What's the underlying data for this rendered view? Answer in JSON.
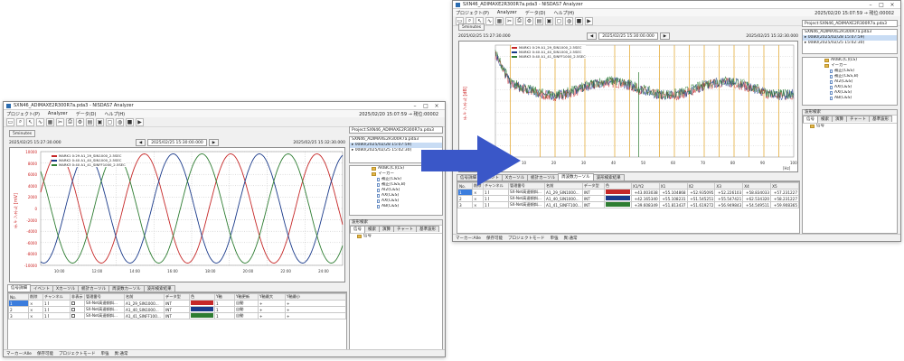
{
  "app": {
    "title": "SXN46_ADIMAXE2R300R7a.pda3 - NISDAS7 Analyzer",
    "menu": [
      "プロジェクト(P)",
      "Analyzer",
      "データ(D)",
      "ヘルプ(H)"
    ],
    "datetime": "2025/02/20 15:07:59 → 残位:00002"
  },
  "left": {
    "project": "Project:SXN46_ADIMAXE2R300R7a.pda3",
    "interval": "5minutes",
    "time_start": "2025/02/25 15:27:30.000",
    "time_center": "2025/02/25 15:30:00.000",
    "time_end": "2025/02/25 15:32:30.000",
    "y_axis_label": "チャンネル [mV]",
    "y_ticks": [
      "10000",
      "8000",
      "6000",
      "4000",
      "2000",
      "0",
      "-2000",
      "-4000",
      "-6000",
      "-8000",
      "-10000"
    ],
    "x_ticks": [
      "10:00",
      "12:00",
      "14:00",
      "16:00",
      "18:00",
      "20:00",
      "22:00",
      "24:00"
    ],
    "legend": [
      "MARK1 0:29 A1_29_SIN1000_2.5SEC",
      "MARK2 0:40 A1_40_SIN1000_2.5SEC",
      "MARK3 0:40 A1_41_SINFF1000_2.5SEC"
    ],
    "file_items": [
      "SXN46_ADIMAXE2R300R7a.pda3",
      "▸ 0080(2025/02/28 15:07:59)",
      "▸ 0080(2025/02/25 15:02:30)"
    ],
    "tree_items": [
      "AI0BC(C)(LS)",
      "マーカー",
      "補正(C&S)",
      "補正(C&S,B)",
      "AI2(C&S)",
      "AX(C&S)",
      "AX(C&S)",
      "AB(C&S)"
    ],
    "tabs": [
      "信号詳細",
      "イベント",
      "Xカーソル",
      "統計カーソル",
      "周波数カーソル",
      "波形検索結果"
    ],
    "columns": [
      "No.",
      "削除",
      "チャンネル",
      "非表示",
      "管理番号",
      "名前",
      "データ型",
      "色",
      "Y軸",
      "Y軸更新",
      "Y軸最大",
      "Y軸最小"
    ],
    "rows": [
      {
        "no": "1",
        "del": "×",
        "ch": "1",
        "mgmt": "SX-Net高速傾斜...",
        "name": "A1_29_SIN1000...",
        "type": "INT",
        "color": "#c62828",
        "y": "1",
        "yupd": "自動",
        "ymax": "+",
        "ymin": "+"
      },
      {
        "no": "2",
        "del": "×",
        "ch": "1",
        "mgmt": "SX-Net高速傾斜...",
        "name": "A1_40_SIN1000...",
        "type": "INT",
        "color": "#1a3a8a",
        "y": "1",
        "yupd": "自動",
        "ymax": "+",
        "ymin": "+"
      },
      {
        "no": "3",
        "del": "×",
        "ch": "1",
        "mgmt": "SX-Net高速傾斜...",
        "name": "A1_41_SINFF100...",
        "type": "INT",
        "color": "#2e7d32",
        "y": "1",
        "yupd": "自動",
        "ymax": "+",
        "ymin": "+"
      }
    ],
    "search_header": "波形検索",
    "search_tabs": [
      "信号",
      "検索",
      "演算",
      "チャート",
      "基準波形"
    ],
    "search_item": "信号",
    "status": [
      "マーカー:AIle",
      "保存可能",
      "プロジェクトモード",
      "単強",
      "異:通常"
    ]
  },
  "right": {
    "project": "Project:SXN46_ADIMAXE2R300R7a.pda3",
    "interval": "5minutes",
    "time_start": "2025/02/25 15:27:30.000",
    "time_center": "2025/02/25 15:30:00.000",
    "time_end": "2025/02/25 15:32:30.000",
    "y_axis_label": "チャンネル [dB]",
    "legend": [
      "MARK1 0:29 A1_29_SIN1000_2.5SEC",
      "MARK2 0:40 A1_40_SIN1000_2.5SEC",
      "MARK3 0:40 A1_41_SINFF1000_2.5SEC"
    ],
    "x_ticks": [
      "10",
      "20",
      "30",
      "40",
      "50",
      "60",
      "70",
      "80",
      "90",
      "100"
    ],
    "x_unit": "[Hz]",
    "file_items": [
      "SXN46_ADIMAXE2R300R7a.pda3",
      "▸ 0080(2025/02/28 15:07:59)",
      "▸ 0080(2025/02/25 15:02:30)"
    ],
    "tree_items": [
      "AI0BC(C)(LS)",
      "マーカー",
      "補正(C&S)",
      "補正(C&S,B)",
      "AI2(C&S)",
      "AX(C&S)",
      "AX(C&S)",
      "AB(C&S)"
    ],
    "tabs": [
      "信号詳細",
      "イベント",
      "Xカーソル",
      "統計カーソル",
      "周波数カーソル",
      "波形検索結果"
    ],
    "columns": [
      "No.",
      "削除",
      "チャンネル",
      "管理番号",
      "名前",
      "データ型",
      "色",
      "X1/Y2",
      "X1",
      "X2",
      "X3",
      "X4",
      "X5"
    ],
    "rows": [
      {
        "no": "1",
        "del": "×",
        "ch": "1",
        "mgmt": "SX-Net高速傾斜...",
        "name": "A1_29_SIN1000...",
        "type": "INT",
        "color": "#c62828",
        "v": [
          "+43.003038",
          "+55.104868",
          "+52.935095",
          "+52.226103",
          "+58.834033",
          "+57.231227"
        ]
      },
      {
        "no": "2",
        "del": "×",
        "ch": "1",
        "mgmt": "SX-Net高速傾斜...",
        "name": "A1_40_SIN1000...",
        "type": "INT",
        "color": "#1a3a8a",
        "v": [
          "+42.165340",
          "+55.108231",
          "+51.545251",
          "+55.547421",
          "+62.534320",
          "+58.231227"
        ]
      },
      {
        "no": "3",
        "del": "×",
        "ch": "1",
        "mgmt": "SX-Net高速傾斜...",
        "name": "A1_41_SINFF100...",
        "type": "INT",
        "color": "#2e7d32",
        "v": [
          "+39.608349",
          "+51.813437",
          "+51.619272",
          "+56.949843",
          "+54.549511",
          "+59.908365"
        ]
      }
    ],
    "search_header": "波形検索",
    "search_tabs": [
      "信号",
      "検索",
      "演算",
      "チャート",
      "基準波形"
    ],
    "search_item": "信号",
    "status": [
      "マーカー:AIle",
      "保存可能",
      "プロジェクトモード",
      "単強",
      "異:通常"
    ]
  },
  "colors": {
    "series1": "#c62828",
    "series2": "#1a3a8a",
    "series3": "#2e7d32",
    "arrow": "#3a57c8",
    "cursor": "#e0a020",
    "accent": "#3b7ddd"
  },
  "chart_data": [
    {
      "type": "line",
      "series": [
        {
          "name": "A1_29_SIN1000_2.5SEC",
          "phase_deg": 0
        },
        {
          "name": "A1_40_SIN1000_2.5SEC",
          "phase_deg": 120
        },
        {
          "name": "A1_41_SINFF1000_2.5SEC",
          "phase_deg": 240
        }
      ],
      "amplitude": 10000,
      "cycles": 3.5,
      "ylim": [
        -10000,
        10000
      ],
      "grid": true,
      "legend": "top-left"
    },
    {
      "type": "line",
      "series": [
        {
          "name": "A1_29_SIN1000_2.5SEC"
        },
        {
          "name": "A1_40_SIN1000_2.5SEC"
        },
        {
          "name": "A1_41_SINFF1000_2.5SEC"
        }
      ],
      "xlim": [
        0,
        100
      ],
      "cursor_x": [
        5,
        15,
        20,
        25,
        30,
        40,
        45,
        55,
        60,
        65,
        70,
        75,
        80,
        85,
        90,
        95
      ],
      "grid": true,
      "legend": "top-left"
    }
  ]
}
